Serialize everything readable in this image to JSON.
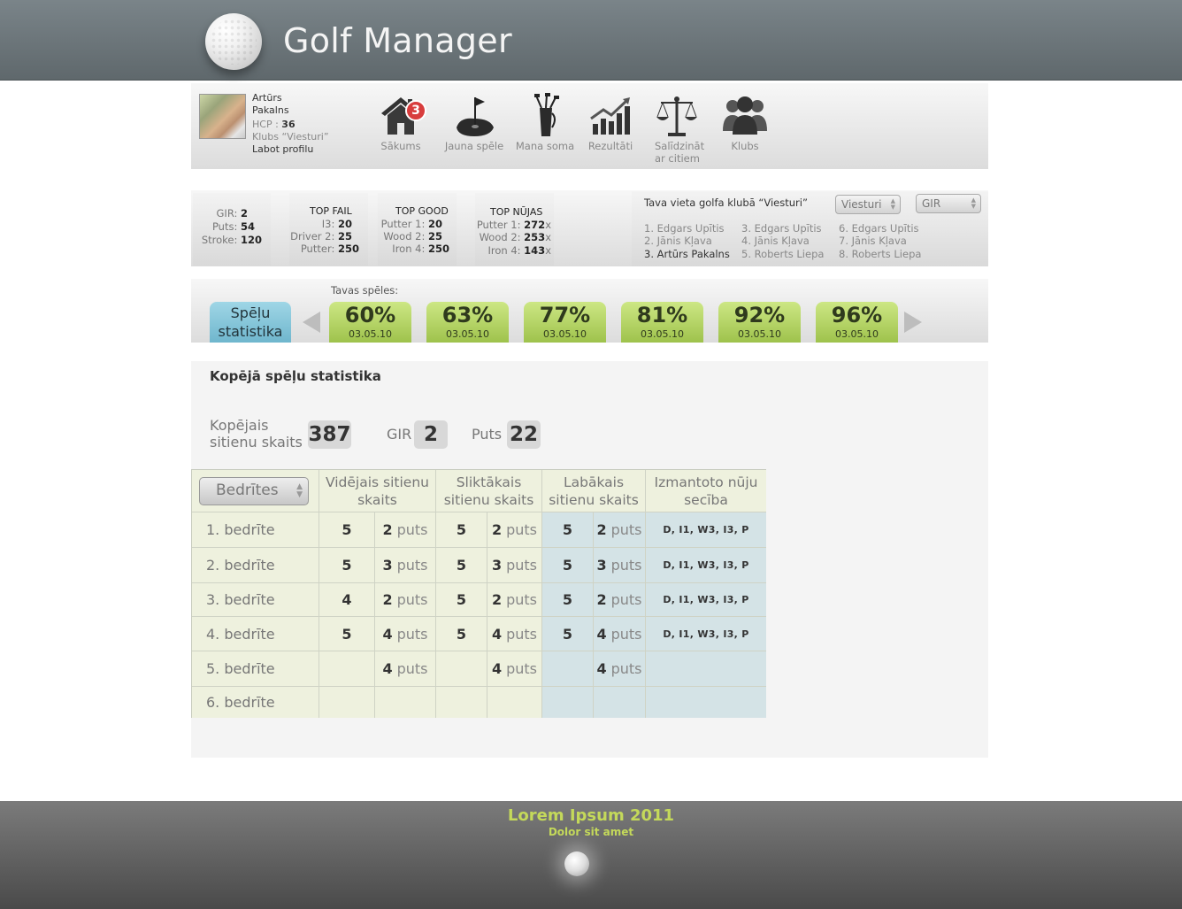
{
  "app": {
    "title": "Golf Manager"
  },
  "profile": {
    "first_name": "Artūrs",
    "last_name": "Pakalns",
    "hcp_label": "HCP :",
    "hcp_value": "36",
    "club": "Klubs “Viesturi”",
    "edit_link": "Labot profilu"
  },
  "nav": {
    "items": [
      {
        "label": "Sākums",
        "icon": "home-icon",
        "badge": "3"
      },
      {
        "label": "Jauna spēle",
        "icon": "golf-hole-flag-icon"
      },
      {
        "label": "Mana soma",
        "icon": "golf-bag-icon"
      },
      {
        "label": "Rezultāti",
        "icon": "chart-up-icon"
      },
      {
        "label": "Salīdzināt",
        "label2": "ar citiem",
        "icon": "scales-icon"
      },
      {
        "label": "Klubs",
        "icon": "people-icon"
      }
    ]
  },
  "summary": {
    "gir_label": "GIR:",
    "gir_value": "2",
    "puts_label": "Puts:",
    "puts_value": "54",
    "stroke_label": "Stroke:",
    "stroke_value": "120"
  },
  "top_fail": {
    "title": "TOP FAIL",
    "rows": [
      {
        "label": "I3:",
        "value": "20"
      },
      {
        "label": "Driver 2:",
        "value": "25"
      },
      {
        "label": "Putter:",
        "value": "250"
      }
    ]
  },
  "top_good": {
    "title": "TOP GOOD",
    "rows": [
      {
        "label": "Putter 1:",
        "value": "20"
      },
      {
        "label": "Wood 2:",
        "value": "25"
      },
      {
        "label": "Iron 4:",
        "value": "250"
      }
    ]
  },
  "top_clubs": {
    "title": "TOP NŪJAS",
    "rows": [
      {
        "label": "Putter 1:",
        "value": "272",
        "suffix": "x"
      },
      {
        "label": "Wood 2:",
        "value": "253",
        "suffix": "x"
      },
      {
        "label": "Iron 4:",
        "value": "143",
        "suffix": "x"
      }
    ]
  },
  "club_rank": {
    "title": "Tava vieta golfa klubā “Viesturi”",
    "club_select": "Viesturi",
    "metric_select": "GIR",
    "col1": [
      "1. Edgars Upītis",
      "2. Jānis Kļava",
      "3. Artūrs Pakalns"
    ],
    "col2": [
      "3. Edgars Upītis",
      "4. Jānis Kļava",
      "5. Roberts Liepa"
    ],
    "col3": [
      "6. Edgars Upītis",
      "7. Jānis Kļava",
      "8. Roberts Liepa"
    ]
  },
  "games": {
    "label": "Tavas spēles:",
    "stats_tab_line1": "Spēļu",
    "stats_tab_line2": "statistika",
    "items": [
      {
        "percent": "60%",
        "date": "03.05.10"
      },
      {
        "percent": "63%",
        "date": "03.05.10"
      },
      {
        "percent": "77%",
        "date": "03.05.10"
      },
      {
        "percent": "81%",
        "date": "03.05.10"
      },
      {
        "percent": "92%",
        "date": "03.05.10"
      },
      {
        "percent": "96%",
        "date": "03.05.10"
      }
    ]
  },
  "overall": {
    "title": "Kopējā spēļu statistika",
    "total_label_1": "Kopējais",
    "total_label_2": "sitienu skaits",
    "total_value": "387",
    "gir_label": "GIR",
    "gir_value": "2",
    "puts_label": "Puts",
    "puts_value": "22"
  },
  "table": {
    "holes_select": "Bedrītes",
    "headers": {
      "avg_1": "Vidējais sitienu",
      "avg_2": "skaits",
      "worst_1": "Sliktākais",
      "worst_2": "sitienu skaits",
      "best_1": "Labākais",
      "best_2": "sitienu skaits",
      "clubs_1": "Izmantoto nūju",
      "clubs_2": "secība"
    },
    "puts_word": "puts",
    "rows": [
      {
        "hole": "1. bedrīte",
        "avg": "5",
        "avg_puts": "2",
        "worst": "5",
        "worst_puts": "2",
        "best": "5",
        "best_puts": "2",
        "clubs": "D, I1, W3, I3, P"
      },
      {
        "hole": "2. bedrīte",
        "avg": "5",
        "avg_puts": "3",
        "worst": "5",
        "worst_puts": "3",
        "best": "5",
        "best_puts": "3",
        "clubs": "D, I1, W3, I3, P"
      },
      {
        "hole": "3. bedrīte",
        "avg": "4",
        "avg_puts": "2",
        "worst": "5",
        "worst_puts": "2",
        "best": "5",
        "best_puts": "2",
        "clubs": "D, I1, W3, I3, P"
      },
      {
        "hole": "4. bedrīte",
        "avg": "5",
        "avg_puts": "4",
        "worst": "5",
        "worst_puts": "4",
        "best": "5",
        "best_puts": "4",
        "clubs": "D, I1, W3, I3, P"
      },
      {
        "hole": "5. bedrīte",
        "avg": "",
        "avg_puts": "4",
        "worst": "",
        "worst_puts": "4",
        "best": "",
        "best_puts": "4",
        "clubs": ""
      },
      {
        "hole": "6. bedrīte",
        "avg": "",
        "avg_puts": "",
        "worst": "",
        "worst_puts": "",
        "best": "",
        "best_puts": "",
        "clubs": ""
      }
    ]
  },
  "footer": {
    "title": "Lorem Ipsum 2011",
    "subtitle": "Dolor sit amet"
  }
}
